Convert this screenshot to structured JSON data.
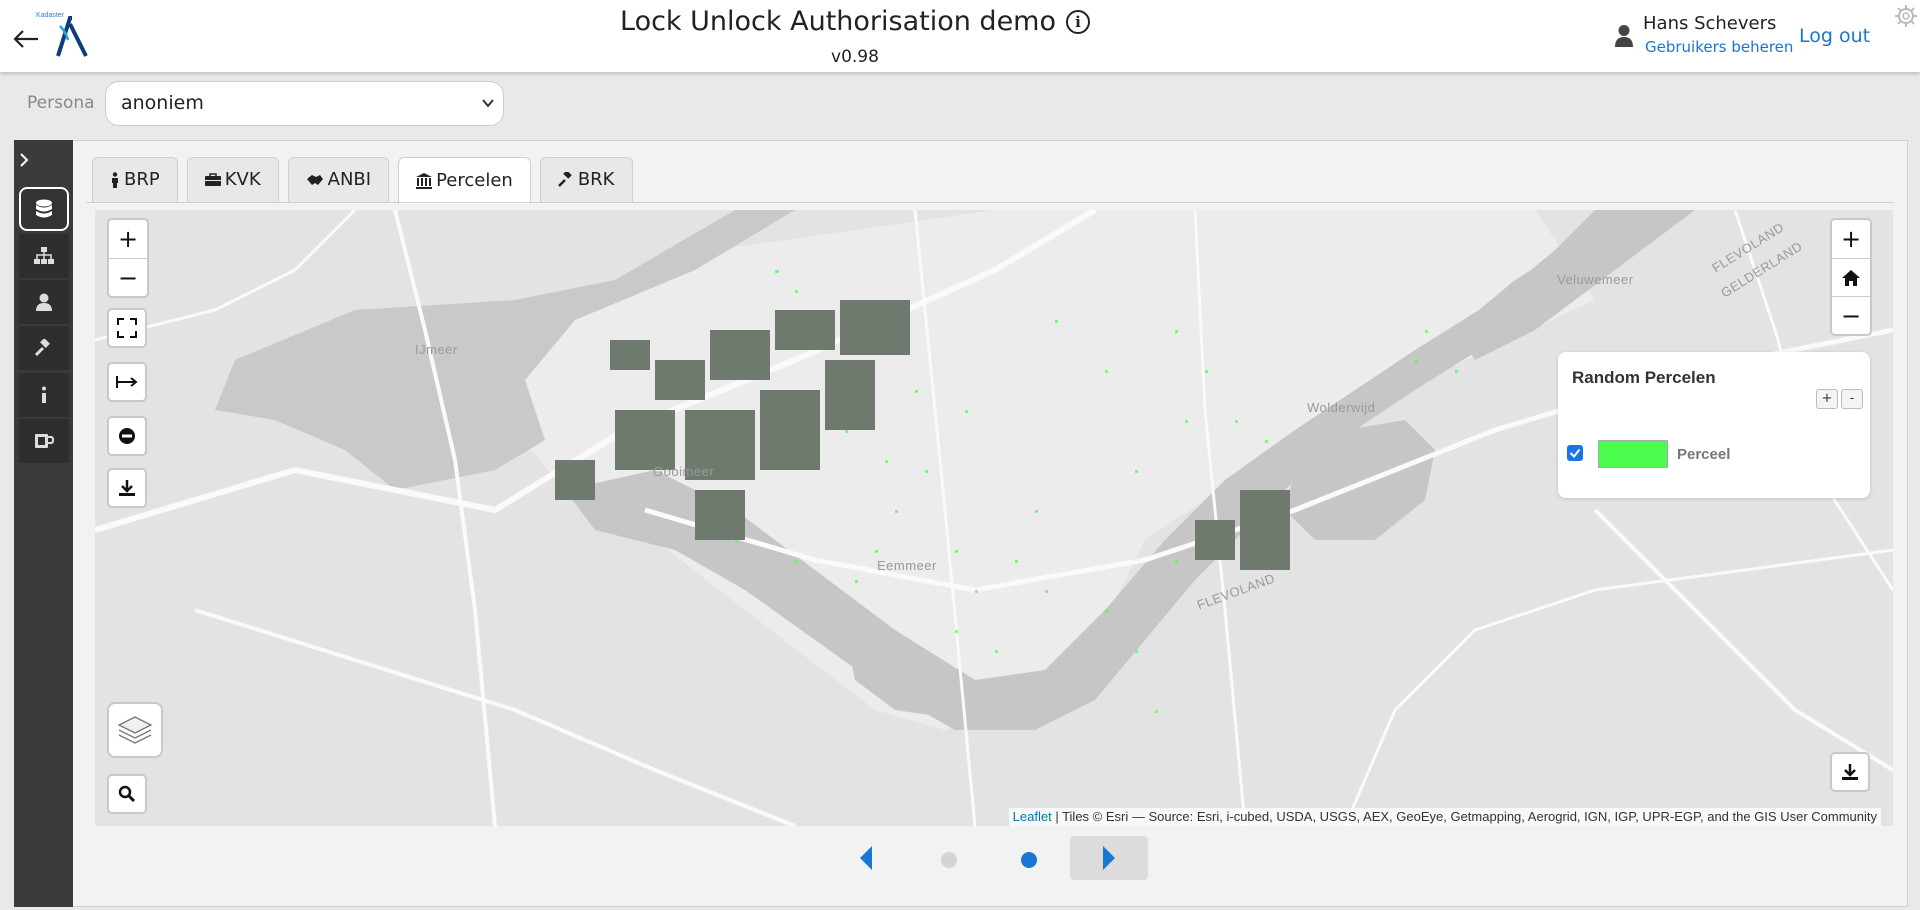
{
  "header": {
    "logo_text": "Kadaster",
    "title": "Lock Unlock Authorisation demo",
    "version": "v0.98",
    "user_name": "Hans Schevers",
    "manage_users": "Gebruikers beheren",
    "logout": "Log out"
  },
  "persona": {
    "label": "Persona",
    "selected": "anoniem"
  },
  "sidebar": {
    "items": [
      {
        "icon": "database-icon"
      },
      {
        "icon": "sitemap-icon"
      },
      {
        "icon": "user-icon"
      },
      {
        "icon": "gavel-icon"
      },
      {
        "icon": "info-icon"
      },
      {
        "icon": "mug-icon"
      }
    ]
  },
  "tabs": [
    {
      "label": "BRP",
      "icon": "person-icon"
    },
    {
      "label": "KVK",
      "icon": "briefcase-icon"
    },
    {
      "label": "ANBI",
      "icon": "handshake-icon"
    },
    {
      "label": "Percelen",
      "icon": "institution-icon",
      "active": true
    },
    {
      "label": "BRK",
      "icon": "gavel-icon"
    }
  ],
  "map": {
    "labels": {
      "ijmeer": "IJmeer",
      "gooimeer": "Gooimeer",
      "eemmeer": "Eemmeer",
      "wolderwijd": "Wolderwijd",
      "veluwemeer": "Veluwemeer",
      "flevoland_south": "FLEVOLAND",
      "flevoland_ne": "FLEVOLAND",
      "gelderland": "GELDERLAND"
    },
    "legend": {
      "title": "Random Percelen",
      "plus": "+",
      "minus": "-",
      "item_label": "Perceel",
      "item_color": "#4cfc4c",
      "checked": true
    },
    "attribution": {
      "leaflet": "Leaflet",
      "separator": " | ",
      "tiles": "Tiles © Esri — Source: Esri, i-cubed, USDA, USGS, AEX, GeoEye, Getmapping, Aerogrid, IGN, IGP, UPR-EGP, and the GIS User Community"
    },
    "controls": {
      "zoom_in": "+",
      "zoom_out": "−",
      "right_zoom_in": "+",
      "right_zoom_out": "−"
    }
  },
  "pager": {
    "dots": [
      {
        "active": false
      },
      {
        "active": true
      }
    ]
  },
  "colors": {
    "accent": "#1976d2",
    "sidebar_bg": "#3a3a3a",
    "parcel_green": "#4cfc4c",
    "water": "#c9c9c9",
    "land": "#e4e4e4"
  }
}
